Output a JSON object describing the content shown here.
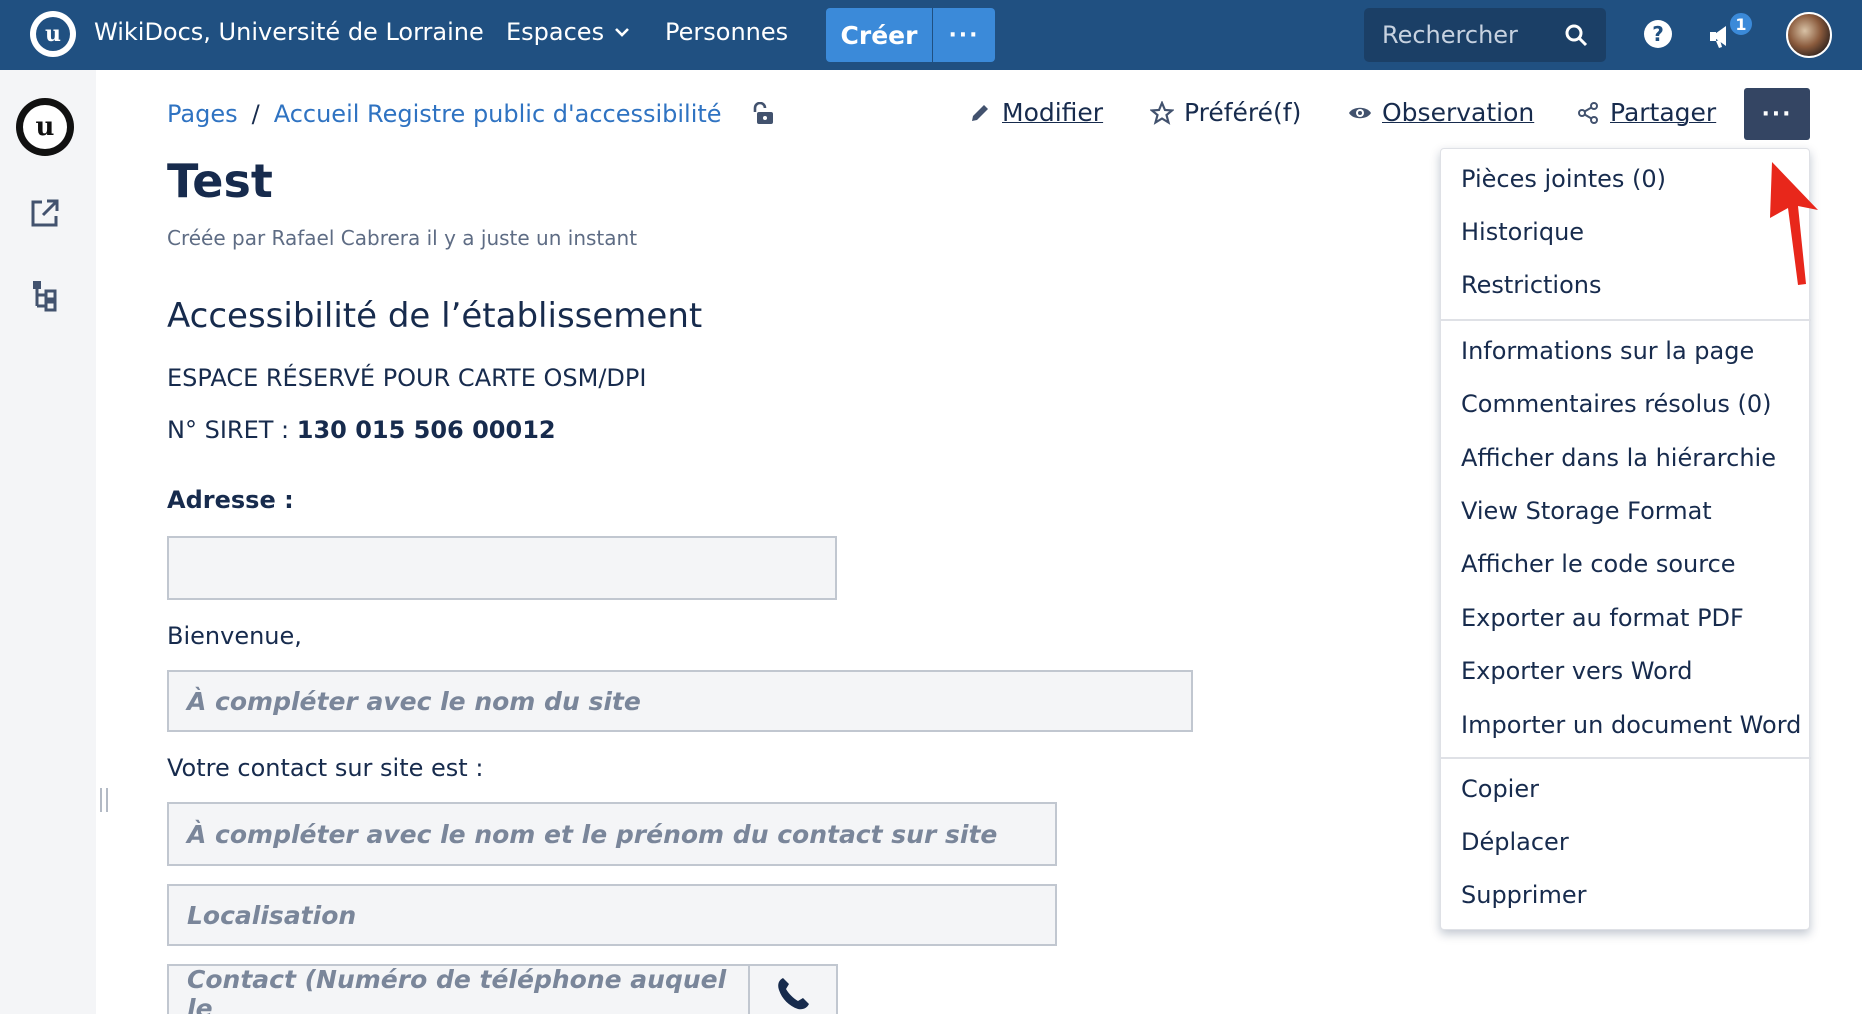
{
  "topbar": {
    "logo_letter": "u",
    "site_title": "WikiDocs, Université de Lorraine",
    "nav_espaces": "Espaces",
    "nav_personnes": "Personnes",
    "create_label": "Créer",
    "create_more_label": "···",
    "search_placeholder": "Rechercher",
    "help_label": "?",
    "notifications_count": "1"
  },
  "sidebar": {
    "space_logo_letter": "u"
  },
  "breadcrumb": {
    "root": "Pages",
    "separator": "/",
    "parent": "Accueil Registre public d'accessibilité"
  },
  "actions": {
    "edit": "Modifier",
    "favorite": "Préféré(f)",
    "watch": "Observation",
    "share": "Partager",
    "more": "···"
  },
  "page": {
    "title": "Test",
    "byline": "Créée par Rafael Cabrera il y a juste un instant",
    "heading": "Accessibilité de l’établissement",
    "map_placeholder": "ESPACE RÉSERVÉ POUR CARTE OSM/DPI",
    "siret_label": "N° SIRET : ",
    "siret_value": "130 015 506 00012",
    "address_label": "Adresse :",
    "welcome_label": "Bienvenue,",
    "site_name_placeholder": "À compléter avec le nom du site",
    "contact_label": "Votre contact sur site est :",
    "contact_name_placeholder": "À compléter avec le nom et le prénom du contact sur site",
    "location_placeholder": "Localisation",
    "phone_placeholder": "Contact (Numéro de téléphone auquel le"
  },
  "menu": {
    "attachments": "Pièces jointes (0)",
    "history": "Historique",
    "restrictions": "Restrictions",
    "page_info": "Informations sur la page",
    "resolved_comments": "Commentaires résolus (0)",
    "view_hierarchy": "Afficher dans la hiérarchie",
    "view_storage": "View Storage Format",
    "view_source": "Afficher le code source",
    "export_pdf": "Exporter au format PDF",
    "export_word": "Exporter vers Word",
    "import_word": "Importer un document Word",
    "copy": "Copier",
    "move": "Déplacer",
    "delete": "Supprimer"
  },
  "colors": {
    "header": "#205081",
    "accent": "#3b8ad9",
    "link": "#2f73c2",
    "annotation_arrow": "#e8271b"
  }
}
